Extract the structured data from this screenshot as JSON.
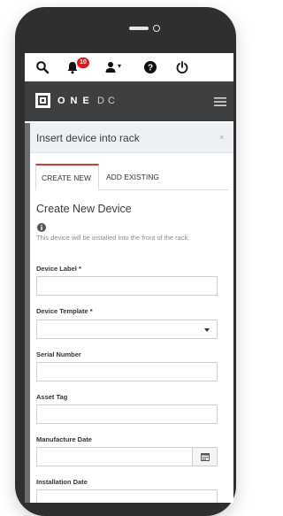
{
  "toolbar": {
    "notification_count": "10",
    "user_caret": "▾"
  },
  "brand": {
    "name_strong": "ONE",
    "name_light": "DC"
  },
  "modal": {
    "title": "Insert device into rack",
    "close": "×",
    "tabs": [
      {
        "label": "CREATE NEW",
        "active": true
      },
      {
        "label": "ADD EXISTING",
        "active": false
      }
    ],
    "section_title": "Create New Device",
    "info_text": "This device will be installed into the front of the rack.",
    "fields": [
      {
        "label": "Device Label *",
        "type": "text",
        "value": ""
      },
      {
        "label": "Device Template *",
        "type": "select",
        "value": ""
      },
      {
        "label": "Serial Number",
        "type": "text",
        "value": ""
      },
      {
        "label": "Asset Tag",
        "type": "text",
        "value": ""
      },
      {
        "label": "Manufacture Date",
        "type": "date",
        "value": ""
      },
      {
        "label": "Installation Date",
        "type": "date",
        "value": ""
      }
    ]
  },
  "colors": {
    "brand_bar": "#3e3f41",
    "accent": "#d33a3a",
    "badge": "#d81b1b"
  }
}
